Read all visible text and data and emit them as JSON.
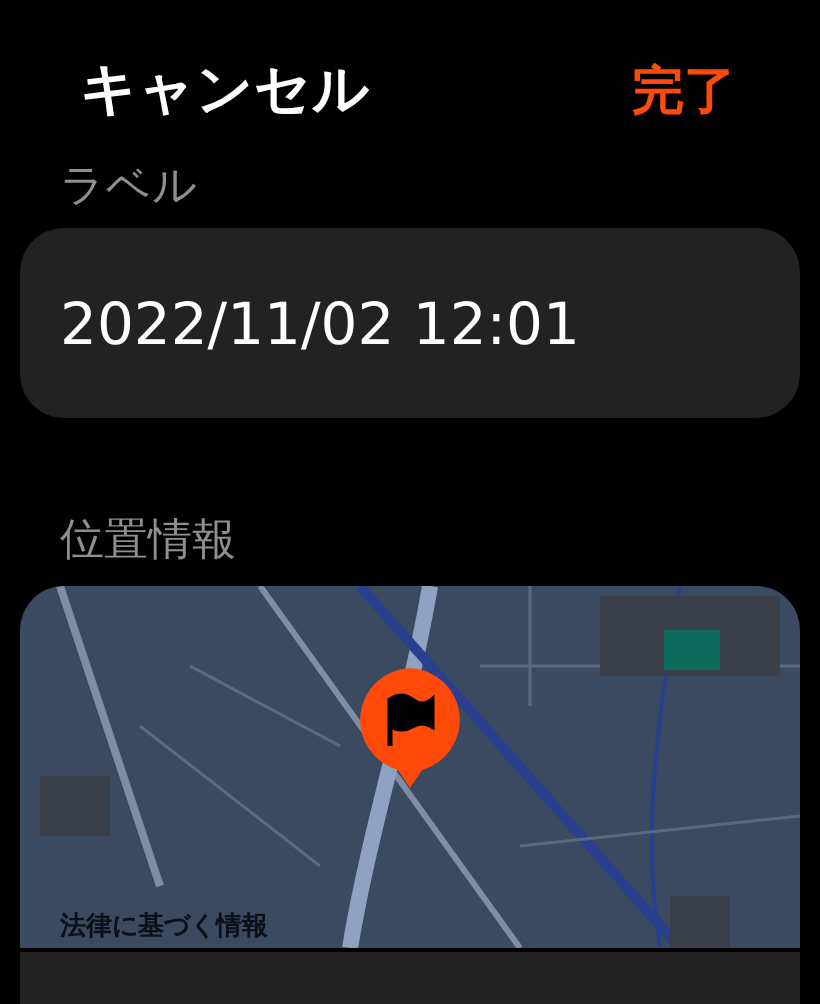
{
  "header": {
    "cancel": "キャンセル",
    "done": "完了"
  },
  "label_section": {
    "title": "ラベル",
    "value": "2022/11/02 12:01"
  },
  "location_section": {
    "title": "位置情報",
    "map": {
      "kind": "picture",
      "legal_link": "法律に基づく情報"
    }
  }
}
